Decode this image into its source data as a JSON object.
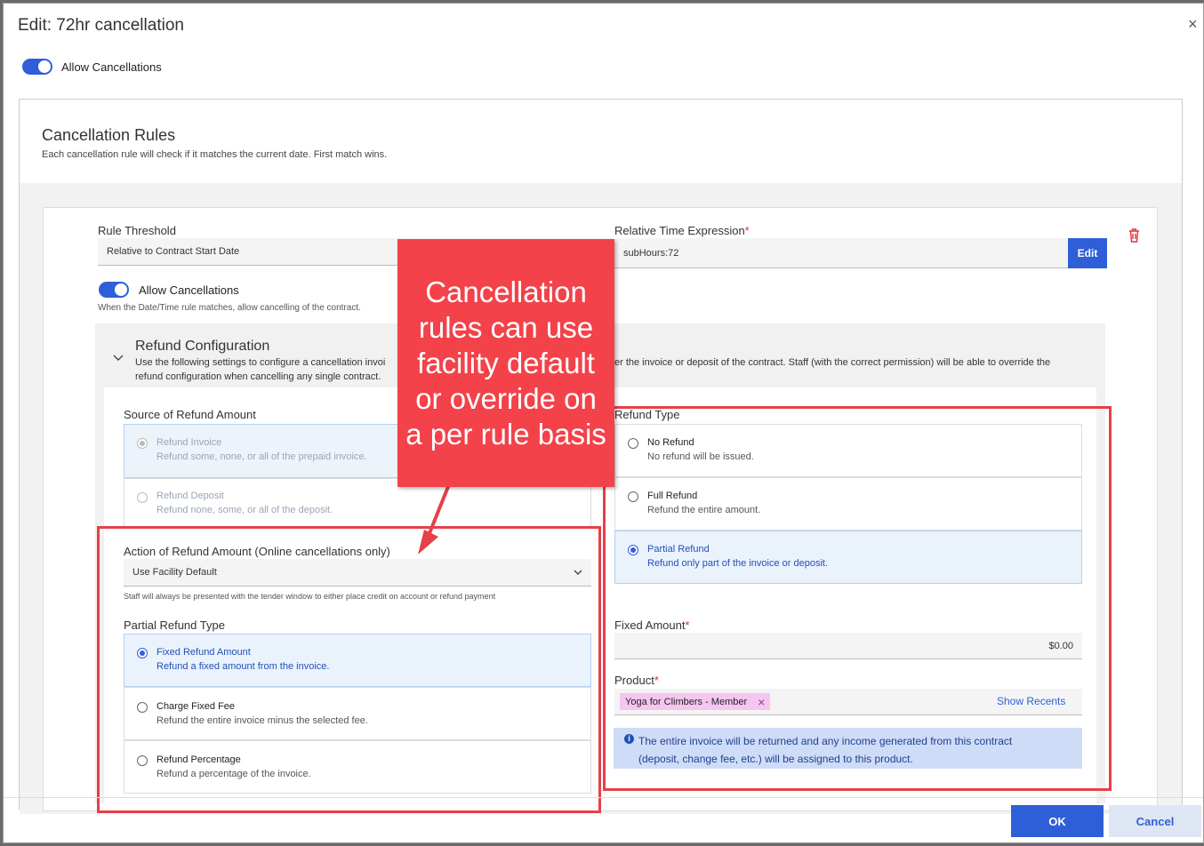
{
  "dialog": {
    "title": "Edit: 72hr cancellation",
    "close_glyph": "×",
    "allow_cancellations_label": "Allow Cancellations"
  },
  "rules": {
    "title": "Cancellation Rules",
    "subtitle": "Each cancellation rule will check if it matches the current date. First match wins."
  },
  "rule": {
    "threshold_label": "Rule Threshold",
    "threshold_value": "Relative to Contract Start Date",
    "time_expr_label": "Relative Time Expression",
    "required_mark": "*",
    "time_expr_value": "subHours:72",
    "edit_label": "Edit",
    "allow_label": "Allow Cancellations",
    "allow_help": "When the Date/Time rule matches, allow cancelling of the contract."
  },
  "refund_config": {
    "title": "Refund Configuration",
    "desc_line1_left": "Use the following settings to configure a cancellation invoi",
    "desc_line1_right": "er the invoice or deposit of the contract. Staff (with the correct permission) will be able to override the",
    "desc_line2": "refund configuration when cancelling any single contract."
  },
  "source": {
    "label": "Source of Refund Amount",
    "options": [
      {
        "title": "Refund Invoice",
        "desc": "Refund some, none, or all of the prepaid invoice."
      },
      {
        "title": "Refund Deposit",
        "desc": "Refund none, some, or all of the deposit."
      }
    ]
  },
  "action": {
    "label": "Action of Refund Amount (Online cancellations only)",
    "value": "Use Facility Default",
    "help": "Staff will always be presented with the tender window to either place credit on account or refund payment"
  },
  "partial": {
    "label": "Partial Refund Type",
    "options": [
      {
        "title": "Fixed Refund Amount",
        "desc": "Refund a fixed amount from the invoice."
      },
      {
        "title": "Charge Fixed Fee",
        "desc": "Refund the entire invoice minus the selected fee."
      },
      {
        "title": "Refund Percentage",
        "desc": "Refund a percentage of the invoice."
      }
    ]
  },
  "refund_type": {
    "label": "Refund Type",
    "options": [
      {
        "title": "No Refund",
        "desc": "No refund will be issued."
      },
      {
        "title": "Full Refund",
        "desc": "Refund the entire amount."
      },
      {
        "title": "Partial Refund",
        "desc": "Refund only part of the invoice or deposit."
      }
    ]
  },
  "fixed_amount": {
    "label": "Fixed Amount",
    "value": "$0.00"
  },
  "product": {
    "label": "Product",
    "tag": "Yoga for Climbers - Member",
    "tag_remove": "×",
    "show_recents": "Show Recents",
    "info_icon": "i",
    "info_line1": "The entire invoice will be returned and any income generated from this contract",
    "info_line2": "(deposit, change fee, etc.) will be assigned to this product."
  },
  "callout": {
    "text": "Cancellation rules can use facility default or override on a per rule basis"
  },
  "footer": {
    "ok_label": "OK",
    "cancel_label": "Cancel"
  },
  "colors": {
    "accent": "#2f5fd8",
    "callout": "#f3424a",
    "highlight_box": "#e64048",
    "delete": "#d33"
  },
  "icons": {
    "delete": "trash-icon",
    "drag": "drag-handle-icon",
    "collapse": "chevron-down-icon",
    "dropdown": "chevron-down-icon",
    "info": "info-icon"
  }
}
